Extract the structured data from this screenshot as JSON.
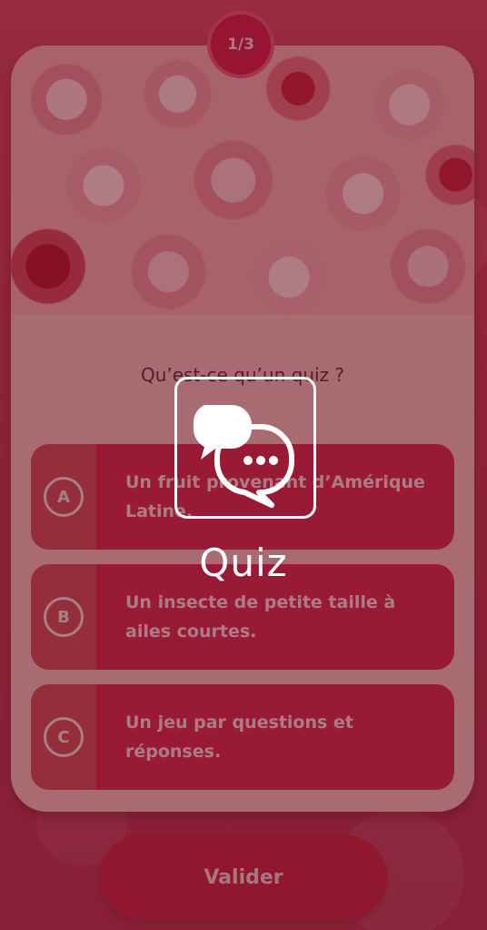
{
  "progress": "1/3",
  "question": "Qu’est-ce qu’un quiz ?",
  "answers": [
    {
      "letter": "A",
      "text": "Un fruit provenant d’Amérique Latine."
    },
    {
      "letter": "B",
      "text": "Un insecte de petite taille à ailes courtes."
    },
    {
      "letter": "C",
      "text": "Un jeu par questions et réponses."
    }
  ],
  "submit_label": "Valider",
  "overlay": {
    "label": "Quiz",
    "icon": "chat-bubbles-icon"
  },
  "colors": {
    "accent": "#d41e49",
    "answer": "#d52a4b",
    "card": "#f6c3c1"
  }
}
